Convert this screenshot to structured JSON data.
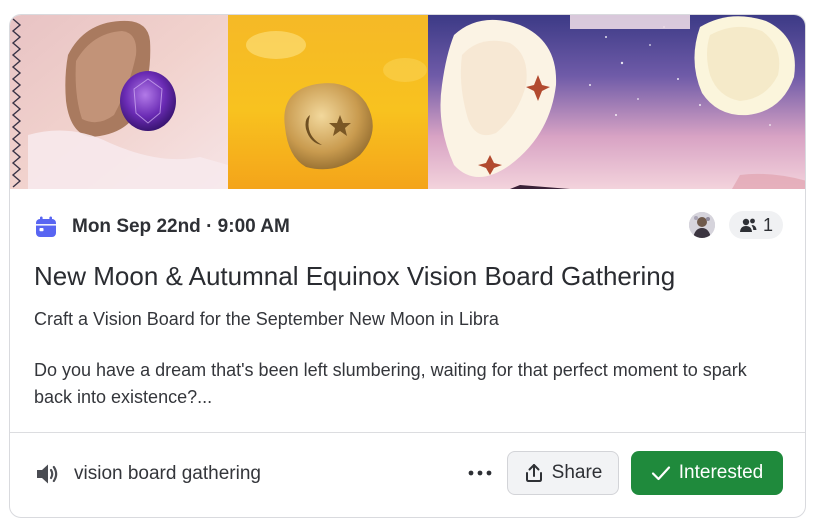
{
  "event": {
    "date_time": "Mon Sep 22nd · 9:00 AM",
    "interested_count": "1",
    "title": "New Moon & Autumnal Equinox Vision Board Gathering",
    "subtitle": "Craft a Vision Board for the September New Moon in Libra",
    "description": "Do you have a dream that's been left slumbering, waiting for that perfect moment to spark back into existence?..."
  },
  "footer": {
    "channel_name": "vision board gathering",
    "share_label": "Share",
    "interested_label": "Interested"
  },
  "icons": {
    "calendar": "calendar-icon",
    "people": "people-icon",
    "speaker": "speaker-icon",
    "more": "more-dots-icon",
    "share": "share-icon",
    "check": "check-icon"
  },
  "colors": {
    "accent_blue": "#5865f2",
    "interested_green": "#1f8a3c",
    "text_primary": "#2e3035"
  }
}
